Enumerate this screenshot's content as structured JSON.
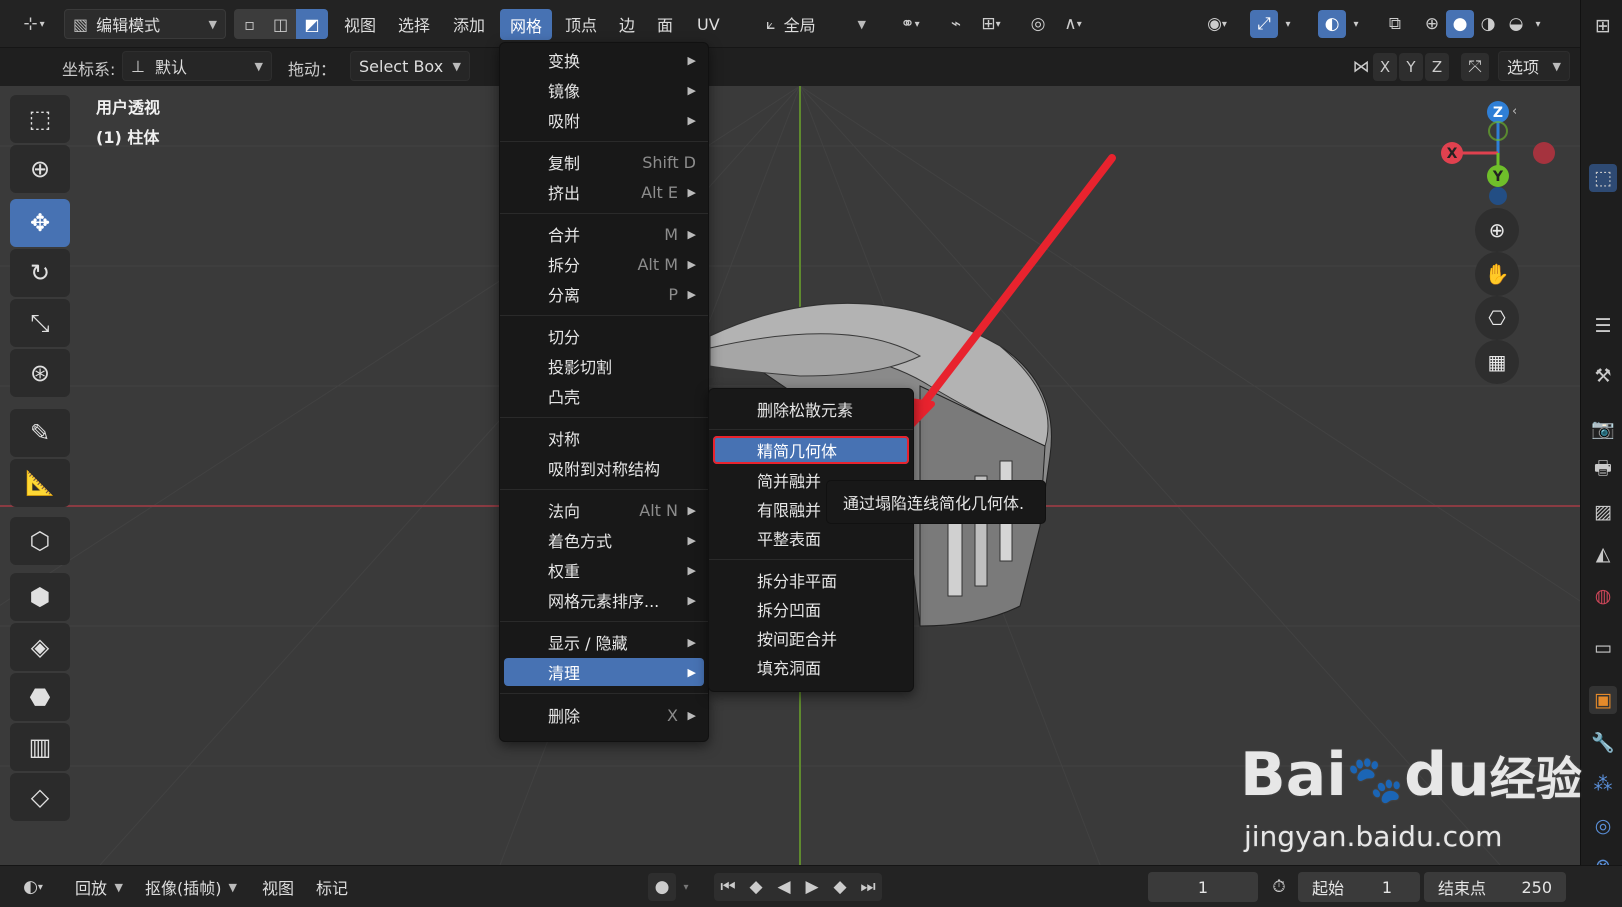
{
  "topbar": {
    "mode_label": "编辑模式",
    "menus": [
      "视图",
      "选择",
      "添加",
      "网格",
      "顶点",
      "边",
      "面",
      "UV"
    ],
    "active_menu": "网格",
    "transform_orientation": "全局"
  },
  "tool_header": {
    "coord_label": "坐标系:",
    "coord_value": "默认",
    "drag_label": "拖动：",
    "drag_value": "Select Box",
    "axis_labels": [
      "X",
      "Y",
      "Z"
    ],
    "options_label": "选项"
  },
  "viewport": {
    "view_name": "用户透视",
    "object_name": "(1) 柱体",
    "gizmo": {
      "x": "X",
      "y": "Y",
      "z": "Z"
    }
  },
  "mesh_menu": {
    "items": [
      {
        "label": "变换",
        "shortcut": "",
        "submenu": true
      },
      {
        "label": "镜像",
        "shortcut": "",
        "submenu": true
      },
      {
        "label": "吸附",
        "shortcut": "",
        "submenu": true
      },
      {
        "label": "复制",
        "shortcut": "Shift D",
        "submenu": false
      },
      {
        "label": "挤出",
        "shortcut": "Alt E",
        "submenu": true
      },
      {
        "label": "合并",
        "shortcut": "M",
        "submenu": true
      },
      {
        "label": "拆分",
        "shortcut": "Alt M",
        "submenu": true
      },
      {
        "label": "分离",
        "shortcut": "P",
        "submenu": true
      },
      {
        "label": "切分",
        "shortcut": "",
        "submenu": false
      },
      {
        "label": "投影切割",
        "shortcut": "",
        "submenu": false
      },
      {
        "label": "凸壳",
        "shortcut": "",
        "submenu": false
      },
      {
        "label": "对称",
        "shortcut": "",
        "submenu": false
      },
      {
        "label": "吸附到对称结构",
        "shortcut": "",
        "submenu": false
      },
      {
        "label": "法向",
        "shortcut": "Alt N",
        "submenu": true
      },
      {
        "label": "着色方式",
        "shortcut": "",
        "submenu": true
      },
      {
        "label": "权重",
        "shortcut": "",
        "submenu": true
      },
      {
        "label": "网格元素排序...",
        "shortcut": "",
        "submenu": true
      },
      {
        "label": "显示 / 隐藏",
        "shortcut": "",
        "submenu": true
      },
      {
        "label": "清理",
        "shortcut": "",
        "submenu": true
      },
      {
        "label": "删除",
        "shortcut": "X",
        "submenu": true
      }
    ]
  },
  "cleanup_menu": {
    "items": [
      "删除松散元素",
      "精简几何体",
      "简并融并",
      "有限融并",
      "平整表面",
      "拆分非平面",
      "拆分凹面",
      "按间距合并",
      "填充洞面"
    ],
    "highlighted": "精简几何体"
  },
  "tooltip": "通过塌陷连线简化几何体.",
  "timeline": {
    "playback_label": "回放",
    "keying_label": "抠像(插帧)",
    "view_label": "视图",
    "marker_label": "标记",
    "current_frame": "1",
    "start_label": "起始",
    "start_value": "1",
    "end_label": "结束点",
    "end_value": "250"
  },
  "watermark": {
    "brand": "Bai",
    "brand2": "du",
    "product": "经验",
    "url": "jingyan.baidu.com"
  },
  "colors": {
    "accent": "#4772b3",
    "arrow": "#e8232e",
    "axis_x": "#e0414f",
    "axis_y": "#6fbf2a",
    "axis_z": "#2f7fd6"
  }
}
